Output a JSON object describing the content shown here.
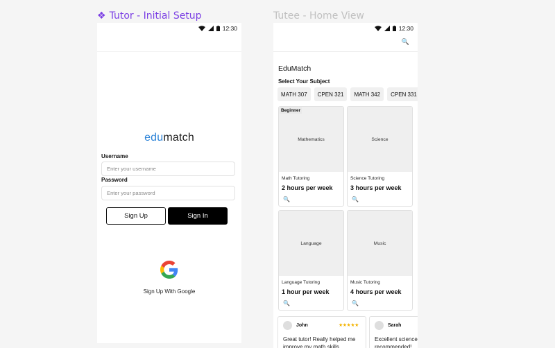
{
  "frames": {
    "tutor_title": "Tutor - Initial Setup",
    "tutee_title": "Tutee - Home View"
  },
  "status_bar": {
    "time": "12:30"
  },
  "login": {
    "logo_part1": "edu",
    "logo_part2": "match",
    "username_label": "Username",
    "username_placeholder": "Enter your username",
    "password_label": "Password",
    "password_placeholder": "Enter your password",
    "signup_label": "Sign Up",
    "signin_label": "Sign In",
    "google_label": "Sign Up With Google"
  },
  "home": {
    "app_title": "EduMatch",
    "subject_prompt": "Select Your Subject",
    "chips": [
      "MATH 307",
      "CPEN 321",
      "MATH 342",
      "CPEN 331"
    ],
    "cards": [
      {
        "image_label": "Mathematics",
        "badge": "Beginner",
        "title": "Math Tutoring",
        "time": "2 hours per week"
      },
      {
        "image_label": "Science",
        "badge": "",
        "title": "Science Tutoring",
        "time": "3 hours per week"
      },
      {
        "image_label": "Language",
        "badge": "",
        "title": "Language Tutoring",
        "time": "1 hour per week"
      },
      {
        "image_label": "Music",
        "badge": "",
        "title": "Music Tutoring",
        "time": "4 hours per week"
      }
    ],
    "reviews": [
      {
        "name": "John",
        "stars": "★★★★★",
        "text": "Great tutor! Really helped me improve my math skills."
      },
      {
        "name": "Sarah",
        "stars": "",
        "text": "Excellent science tutor. Highly recommended!"
      }
    ]
  },
  "colors": {
    "frame_title_active": "#7b3fe4",
    "frame_title_inactive": "#c0c0c0",
    "logo_edu": "#2f85d8",
    "star": "#f3b300"
  },
  "icons": [
    "component-icon",
    "wifi-icon",
    "signal-icon",
    "battery-icon",
    "search-icon",
    "google-logo-icon",
    "avatar-icon",
    "star-icon"
  ]
}
